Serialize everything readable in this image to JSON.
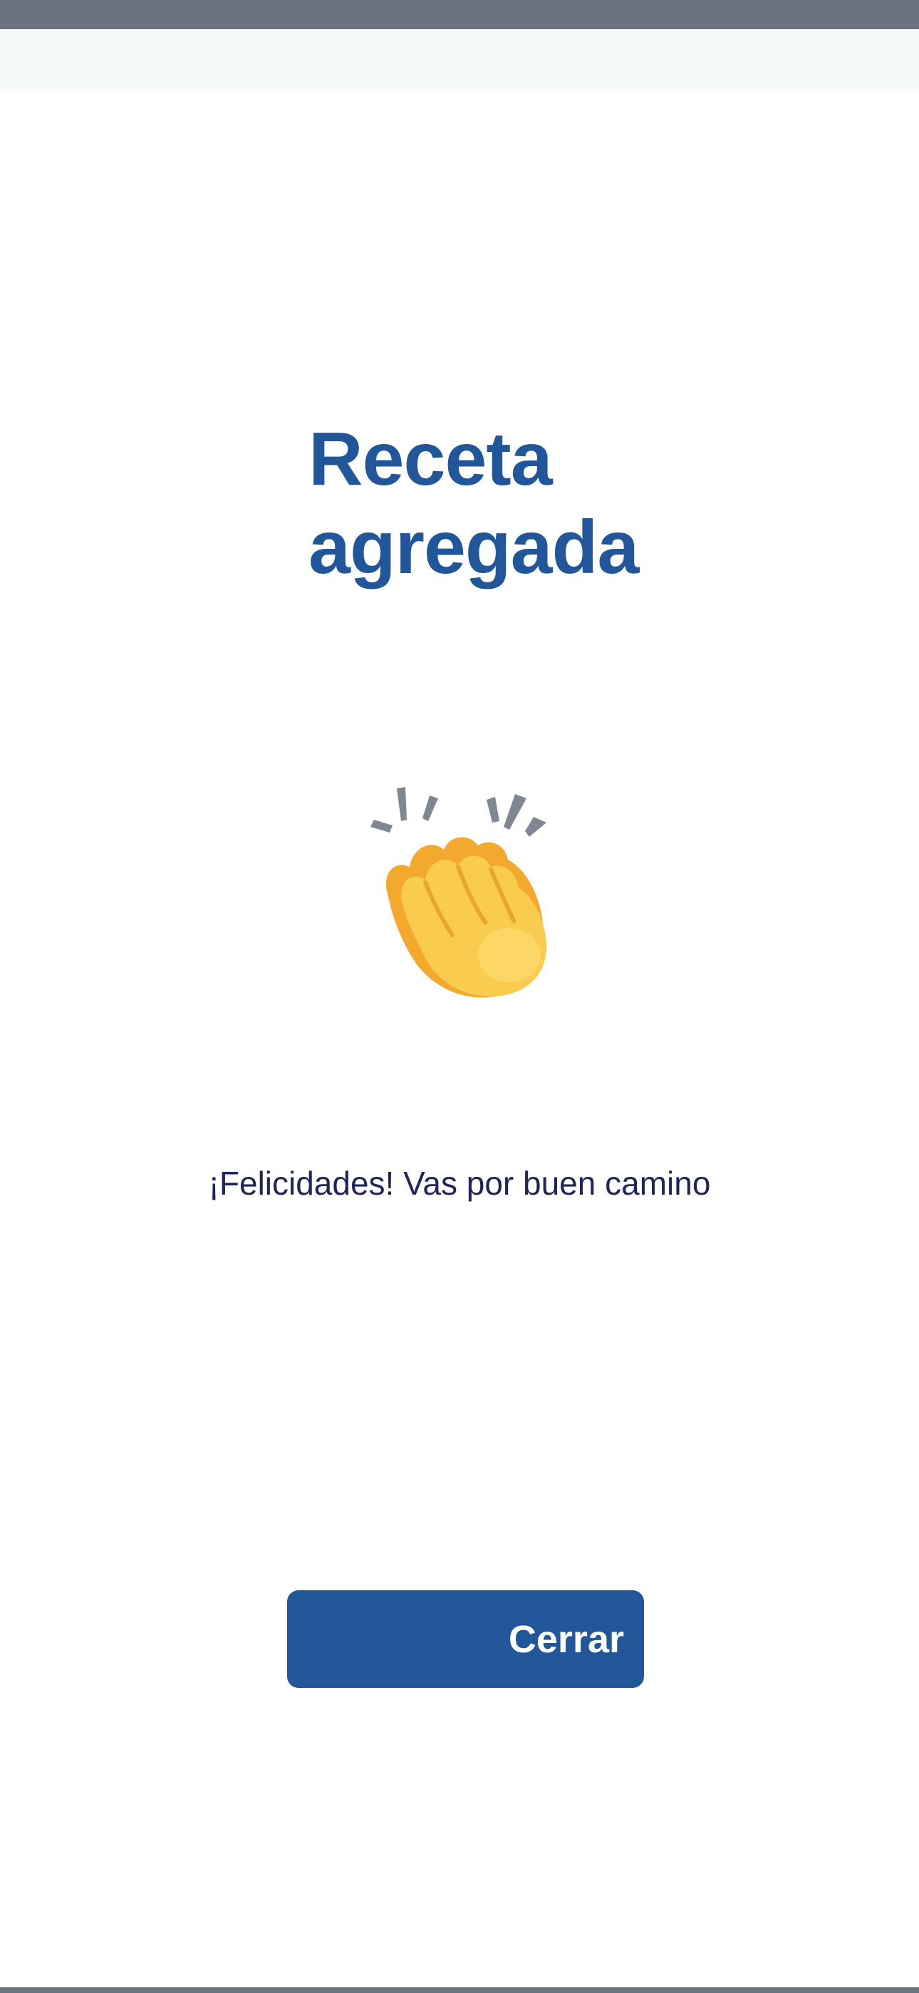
{
  "screen": {
    "title_line1": "Receta",
    "title_line2": "agregada",
    "icon": "clapping-hands-icon",
    "message": "¡Felicidades! Vas por buen camino",
    "close_label": "Cerrar"
  },
  "colors": {
    "primary": "#21579a",
    "text": "#1f2557",
    "status_bar": "#6b737e",
    "top_strip": "#f6fafa",
    "background": "#ffffff"
  }
}
